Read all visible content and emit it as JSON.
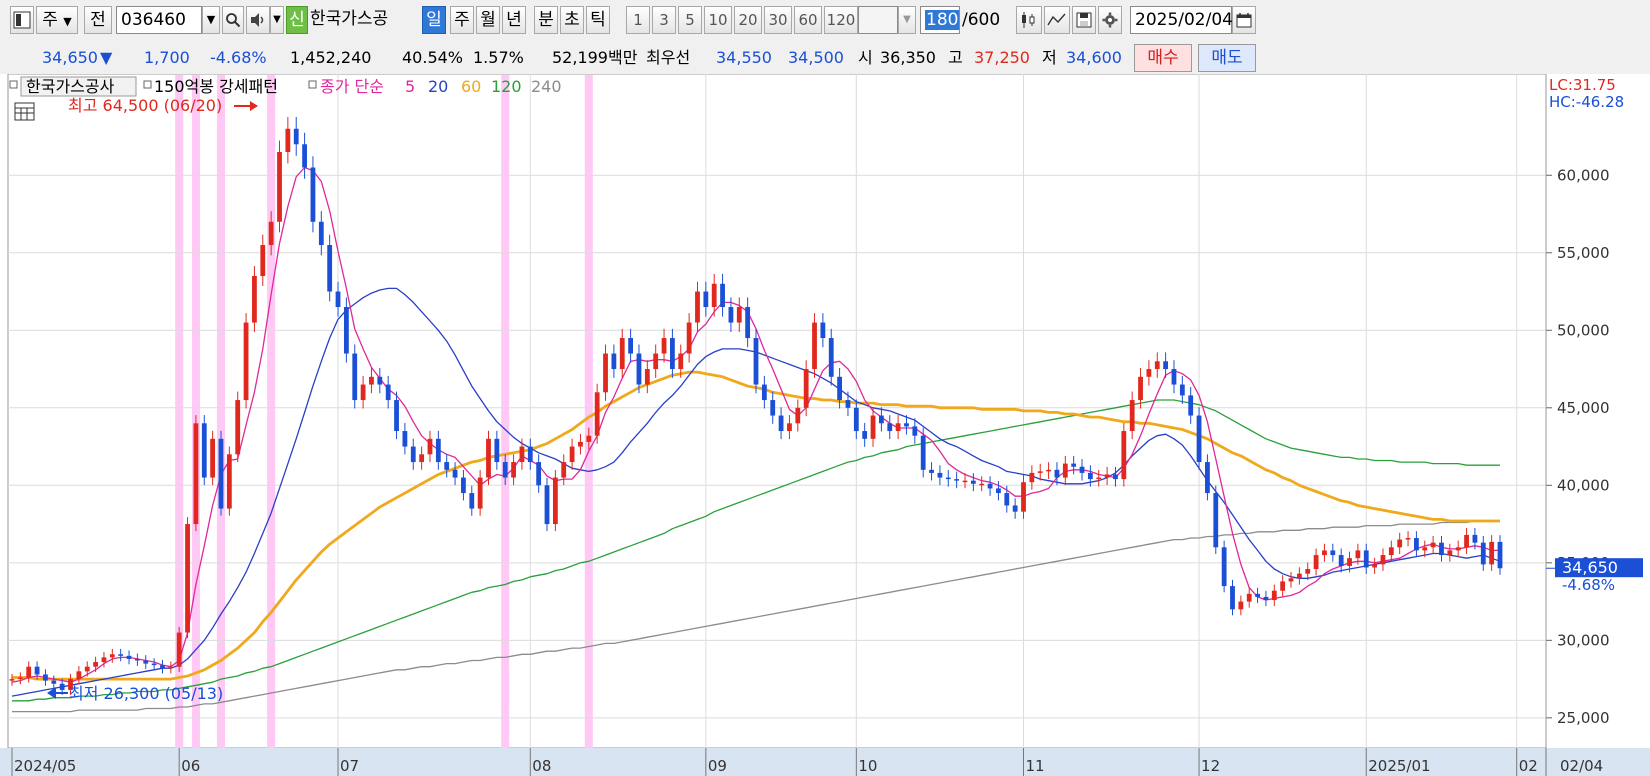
{
  "toolbar": {
    "type_label": "주",
    "prev_label": "전",
    "code": "036460",
    "new_badge": "신",
    "stock_name": "한국가스공",
    "periods": [
      "일",
      "주",
      "월",
      "년",
      "분",
      "초",
      "틱"
    ],
    "active_period": "일",
    "interval_numbers": [
      "1",
      "3",
      "5",
      "10",
      "20",
      "30",
      "60",
      "120"
    ],
    "count_value": "180",
    "count_max": "/600",
    "date": "2025/02/04"
  },
  "quote": {
    "price": "34,650",
    "direction": "▼",
    "change": "1,700",
    "change_pct": "-4.68%",
    "volume": "1,452,240",
    "ratio1": "40.54%",
    "ratio2": "1.57%",
    "amount": "52,199백만",
    "best_label": "최우선",
    "best_ask": "34,550",
    "best_bid": "34,500",
    "open_label": "시",
    "open": "36,350",
    "high_label": "고",
    "high": "37,250",
    "low_label": "저",
    "low": "34,600",
    "buy_label": "매수",
    "sell_label": "매도"
  },
  "colors": {
    "up": "#e0281e",
    "down": "#1a4fd6",
    "ma5": "#e0289a",
    "ma20": "#2a3fc8",
    "ma60": "#f0a81c",
    "ma120": "#2aa03a",
    "ma240": "#8c8c8c",
    "pattern": "#ffc8f5"
  },
  "chart_data": {
    "type": "candlestick",
    "legend_name": "한국가스공사",
    "pattern_label": "150억봉 강세패턴",
    "ma_label": "종가 단순",
    "ma_periods": [
      "5",
      "20",
      "60",
      "120",
      "240"
    ],
    "corner_labels": [
      "LC:31.75",
      "HC:-46.28"
    ],
    "price_tag": "34,650",
    "pct_tag": "-4.68%",
    "high_annotation": "최고 64,500 (06/20)",
    "low_annotation": "최저 26,300 (05/13)",
    "y_ticks": [
      "60,000",
      "55,000",
      "50,000",
      "45,000",
      "40,000",
      "35,000",
      "30,000",
      "25,000"
    ],
    "ylim": [
      23700,
      65500
    ],
    "x_labels": [
      "2024/05",
      "06",
      "07",
      "08",
      "09",
      "10",
      "11",
      "12",
      "2025/01",
      "02"
    ],
    "last_date": "02/04",
    "dates": [
      "2024-05-02",
      "2024-05-03",
      "2024-05-07",
      "2024-05-08",
      "2024-05-09",
      "2024-05-10",
      "2024-05-13",
      "2024-05-14",
      "2024-05-16",
      "2024-05-17",
      "2024-05-20",
      "2024-05-21",
      "2024-05-22",
      "2024-05-23",
      "2024-05-24",
      "2024-05-27",
      "2024-05-28",
      "2024-05-29",
      "2024-05-30",
      "2024-05-31",
      "2024-06-03",
      "2024-06-04",
      "2024-06-05",
      "2024-06-07",
      "2024-06-10",
      "2024-06-11",
      "2024-06-12",
      "2024-06-13",
      "2024-06-14",
      "2024-06-17",
      "2024-06-18",
      "2024-06-19",
      "2024-06-20",
      "2024-06-21",
      "2024-06-24",
      "2024-06-25",
      "2024-06-26",
      "2024-06-27",
      "2024-06-28",
      "2024-07-01",
      "2024-07-02",
      "2024-07-03",
      "2024-07-04",
      "2024-07-05",
      "2024-07-08",
      "2024-07-09",
      "2024-07-10",
      "2024-07-11",
      "2024-07-12",
      "2024-07-15",
      "2024-07-16",
      "2024-07-17",
      "2024-07-18",
      "2024-07-19",
      "2024-07-22",
      "2024-07-23",
      "2024-07-24",
      "2024-07-25",
      "2024-07-26",
      "2024-07-29",
      "2024-07-30",
      "2024-07-31",
      "2024-08-01",
      "2024-08-02",
      "2024-08-05",
      "2024-08-06",
      "2024-08-07",
      "2024-08-08",
      "2024-08-09",
      "2024-08-12",
      "2024-08-13",
      "2024-08-14",
      "2024-08-16",
      "2024-08-19",
      "2024-08-20",
      "2024-08-21",
      "2024-08-22",
      "2024-08-23",
      "2024-08-26",
      "2024-08-27",
      "2024-08-28",
      "2024-08-29",
      "2024-08-30",
      "2024-09-02",
      "2024-09-03",
      "2024-09-04",
      "2024-09-05",
      "2024-09-06",
      "2024-09-09",
      "2024-09-10",
      "2024-09-11",
      "2024-09-12",
      "2024-09-13",
      "2024-09-19",
      "2024-09-20",
      "2024-09-23",
      "2024-09-24",
      "2024-09-25",
      "2024-09-26",
      "2024-09-27",
      "2024-09-30",
      "2024-10-02",
      "2024-10-04",
      "2024-10-07",
      "2024-10-08",
      "2024-10-10",
      "2024-10-11",
      "2024-10-14",
      "2024-10-15",
      "2024-10-16",
      "2024-10-17",
      "2024-10-18",
      "2024-10-21",
      "2024-10-22",
      "2024-10-23",
      "2024-10-24",
      "2024-10-25",
      "2024-10-28",
      "2024-10-29",
      "2024-10-30",
      "2024-10-31",
      "2024-11-01",
      "2024-11-04",
      "2024-11-05",
      "2024-11-06",
      "2024-11-07",
      "2024-11-08",
      "2024-11-11",
      "2024-11-12",
      "2024-11-13",
      "2024-11-14",
      "2024-11-15",
      "2024-11-18",
      "2024-11-19",
      "2024-11-20",
      "2024-11-21",
      "2024-11-22",
      "2024-11-25",
      "2024-11-26",
      "2024-11-27",
      "2024-11-28",
      "2024-11-29",
      "2024-12-02",
      "2024-12-03",
      "2024-12-04",
      "2024-12-05",
      "2024-12-06",
      "2024-12-09",
      "2024-12-10",
      "2024-12-11",
      "2024-12-12",
      "2024-12-13",
      "2024-12-16",
      "2024-12-17",
      "2024-12-18",
      "2024-12-19",
      "2024-12-20",
      "2024-12-23",
      "2024-12-24",
      "2024-12-26",
      "2024-12-27",
      "2024-12-30",
      "2025-01-02",
      "2025-01-03",
      "2025-01-06",
      "2025-01-07",
      "2025-01-08",
      "2025-01-09",
      "2025-01-10",
      "2025-01-13",
      "2025-01-14",
      "2025-01-15",
      "2025-01-16",
      "2025-01-17",
      "2025-01-20",
      "2025-01-21",
      "2025-01-22",
      "2025-01-23",
      "2025-01-24",
      "2025-01-31",
      "2025-02-03",
      "2025-02-04"
    ],
    "close": [
      27500,
      27600,
      28300,
      27800,
      27400,
      27200,
      26800,
      27500,
      28000,
      28300,
      28600,
      28900,
      29100,
      29000,
      28800,
      28700,
      28500,
      28400,
      28200,
      28300,
      30500,
      37500,
      44000,
      40500,
      43000,
      38500,
      42000,
      45500,
      50500,
      53500,
      55500,
      57000,
      61500,
      63000,
      62000,
      60500,
      57000,
      55500,
      52500,
      51500,
      48500,
      45500,
      46500,
      47000,
      46500,
      45500,
      43500,
      42500,
      41500,
      42000,
      43000,
      41500,
      41000,
      40500,
      39500,
      38500,
      40500,
      43000,
      41500,
      40500,
      41500,
      42500,
      41500,
      40000,
      37500,
      40500,
      41500,
      42500,
      42800,
      43200,
      46000,
      48500,
      47500,
      49500,
      48500,
      46500,
      47500,
      48500,
      49500,
      47500,
      48500,
      50500,
      52500,
      51500,
      53000,
      51500,
      50500,
      51500,
      49500,
      46500,
      45500,
      44500,
      43500,
      44000,
      45000,
      47500,
      50500,
      49500,
      47000,
      45500,
      45000,
      43500,
      43000,
      44500,
      44000,
      43500,
      44000,
      43800,
      43200,
      41000,
      40800,
      40500,
      40400,
      40300,
      40300,
      40100,
      40100,
      39800,
      39500,
      38700,
      38300,
      40200,
      40800,
      40900,
      41000,
      40500,
      41400,
      41200,
      40800,
      40400,
      40500,
      40700,
      40400,
      43500,
      45500,
      47000,
      47500,
      48000,
      47500,
      46500,
      45800,
      44500,
      41500,
      39500,
      36000,
      33500,
      32000,
      32500,
      33000,
      32800,
      32600,
      33200,
      33800,
      34000,
      34300,
      34600,
      35500,
      35800,
      35500,
      34800,
      35300,
      35800,
      34700,
      34900,
      35500,
      36000,
      36500,
      36600,
      35800,
      36000,
      36300,
      35500,
      35800,
      36000,
      36800,
      36300,
      34900,
      36350,
      34650
    ],
    "ma5": [
      27300,
      27400,
      27600,
      27700,
      27600,
      27500,
      27400,
      27300,
      27500,
      27800,
      28100,
      28500,
      28800,
      28900,
      28900,
      28800,
      28700,
      28600,
      28400,
      28300,
      28700,
      30500,
      33600,
      36100,
      38700,
      40700,
      41600,
      41700,
      43900,
      46000,
      48800,
      52300,
      55600,
      58000,
      59900,
      60500,
      60300,
      59600,
      57700,
      55100,
      52700,
      50100,
      48800,
      47600,
      46900,
      46200,
      45800,
      45100,
      44100,
      43200,
      42700,
      42300,
      42000,
      41800,
      41200,
      40600,
      40000,
      40400,
      40700,
      40600,
      41100,
      41900,
      41600,
      41300,
      40600,
      40300,
      40400,
      40400,
      41000,
      42200,
      43200,
      44700,
      45700,
      46900,
      48000,
      48100,
      48000,
      48100,
      48100,
      48000,
      48300,
      48800,
      49900,
      50400,
      51200,
      51800,
      51800,
      51600,
      51200,
      50100,
      48700,
      47500,
      46200,
      44900,
      44500,
      45000,
      46200,
      47400,
      47900,
      48000,
      47500,
      46700,
      45500,
      44800,
      44400,
      44000,
      43700,
      43700,
      43700,
      43300,
      42900,
      42200,
      41400,
      41000,
      40700,
      40500,
      40300,
      40200,
      40000,
      39700,
      39300,
      39300,
      39500,
      39600,
      39800,
      40500,
      40900,
      41000,
      41000,
      40900,
      40700,
      40600,
      40500,
      41100,
      42000,
      43200,
      44600,
      45900,
      47100,
      47400,
      47200,
      46800,
      45800,
      44100,
      41700,
      39300,
      36900,
      34900,
      33400,
      32800,
      32600,
      32700,
      32800,
      32900,
      33100,
      33500,
      33800,
      34300,
      34600,
      34800,
      35000,
      35100,
      35100,
      35000,
      35100,
      35200,
      35300,
      35600,
      35900,
      36100,
      36200,
      36000,
      35900,
      35900,
      36000,
      36100,
      36000,
      35800,
      35800
    ],
    "ma20": [
      26400,
      26500,
      26600,
      26700,
      26800,
      26900,
      27000,
      27100,
      27200,
      27300,
      27400,
      27500,
      27600,
      27700,
      27800,
      27900,
      28000,
      28100,
      28200,
      28200,
      28400,
      28800,
      29400,
      30000,
      30800,
      31700,
      32500,
      33400,
      34400,
      35600,
      36900,
      38200,
      39800,
      41400,
      43000,
      44700,
      46400,
      48000,
      49500,
      50700,
      51300,
      51700,
      52100,
      52400,
      52600,
      52700,
      52700,
      52300,
      51800,
      51200,
      50600,
      50000,
      49300,
      48400,
      47400,
      46400,
      45600,
      44800,
      44100,
      43600,
      43100,
      42700,
      42400,
      42100,
      41900,
      41700,
      41400,
      41100,
      41000,
      40900,
      41000,
      41200,
      41500,
      42100,
      42800,
      43400,
      44000,
      44700,
      45300,
      45800,
      46400,
      47100,
      47800,
      48300,
      48600,
      48800,
      48800,
      48800,
      48700,
      48600,
      48400,
      48200,
      48000,
      47800,
      47600,
      47400,
      47200,
      46900,
      46600,
      46200,
      45800,
      45400,
      45200,
      45000,
      44900,
      44800,
      44600,
      44400,
      44200,
      43800,
      43400,
      43000,
      42700,
      42500,
      42200,
      41900,
      41600,
      41400,
      41200,
      40900,
      40800,
      40700,
      40600,
      40400,
      40300,
      40200,
      40100,
      40100,
      40100,
      40200,
      40300,
      40500,
      40800,
      41300,
      41900,
      42400,
      42900,
      43200,
      43300,
      43000,
      42600,
      41900,
      41100,
      40300,
      39600,
      38900,
      38100,
      37300,
      36500,
      35800,
      35100,
      34600,
      34300,
      34100,
      34000,
      34000,
      34100,
      34200,
      34400,
      34500,
      34600,
      34700,
      34800,
      34900,
      35000,
      35100,
      35200,
      35300,
      35400,
      35500,
      35600,
      35600,
      35500,
      35400,
      35300,
      35400,
      35500,
      35300,
      35100
    ],
    "ma60": [
      27600,
      27600,
      27600,
      27500,
      27500,
      27500,
      27500,
      27500,
      27500,
      27500,
      27500,
      27500,
      27500,
      27500,
      27500,
      27500,
      27500,
      27500,
      27500,
      27500,
      27600,
      27700,
      27900,
      28100,
      28400,
      28700,
      29100,
      29500,
      30000,
      30500,
      31200,
      31800,
      32500,
      33200,
      33900,
      34500,
      35100,
      35700,
      36200,
      36600,
      37000,
      37400,
      37800,
      38200,
      38600,
      38900,
      39200,
      39500,
      39800,
      40100,
      40400,
      40700,
      40900,
      41100,
      41300,
      41500,
      41600,
      41800,
      41900,
      42000,
      42100,
      42200,
      42300,
      42500,
      42700,
      43000,
      43300,
      43600,
      44000,
      44400,
      44700,
      45100,
      45400,
      45700,
      46000,
      46300,
      46500,
      46700,
      46900,
      47100,
      47200,
      47300,
      47300,
      47200,
      47100,
      47000,
      46800,
      46600,
      46400,
      46300,
      46200,
      46000,
      45900,
      45800,
      45700,
      45600,
      45600,
      45500,
      45500,
      45400,
      45400,
      45300,
      45300,
      45300,
      45200,
      45200,
      45200,
      45100,
      45100,
      45100,
      45100,
      45000,
      45000,
      45000,
      45000,
      45000,
      44900,
      44900,
      44900,
      44900,
      44900,
      44800,
      44800,
      44800,
      44700,
      44700,
      44600,
      44600,
      44500,
      44400,
      44400,
      44300,
      44200,
      44100,
      44100,
      44000,
      44000,
      43900,
      43800,
      43700,
      43600,
      43400,
      43200,
      43000,
      42700,
      42400,
      42100,
      41900,
      41600,
      41300,
      41000,
      40800,
      40500,
      40300,
      40000,
      39800,
      39600,
      39400,
      39200,
      39000,
      38900,
      38700,
      38600,
      38500,
      38400,
      38300,
      38200,
      38100,
      38000,
      37900,
      37800,
      37800,
      37700,
      37700,
      37700,
      37700,
      37700,
      37700,
      37700
    ],
    "ma120": [
      26100,
      26100,
      26100,
      26200,
      26200,
      26300,
      26300,
      26300,
      26400,
      26400,
      26400,
      26500,
      26500,
      26600,
      26600,
      26700,
      26700,
      26700,
      26800,
      26800,
      26900,
      27000,
      27100,
      27200,
      27300,
      27500,
      27600,
      27700,
      27900,
      28000,
      28200,
      28300,
      28500,
      28700,
      28900,
      29100,
      29300,
      29500,
      29700,
      29900,
      30100,
      30300,
      30500,
      30700,
      30900,
      31100,
      31300,
      31500,
      31700,
      31900,
      32100,
      32300,
      32500,
      32700,
      32900,
      33100,
      33200,
      33400,
      33500,
      33600,
      33800,
      33900,
      34100,
      34200,
      34300,
      34500,
      34600,
      34800,
      35000,
      35100,
      35300,
      35500,
      35700,
      35900,
      36100,
      36300,
      36500,
      36700,
      36900,
      37200,
      37400,
      37600,
      37800,
      38000,
      38300,
      38500,
      38700,
      38900,
      39100,
      39300,
      39500,
      39700,
      39900,
      40100,
      40300,
      40500,
      40700,
      40900,
      41100,
      41300,
      41500,
      41600,
      41800,
      41900,
      42100,
      42200,
      42300,
      42500,
      42600,
      42700,
      42800,
      42900,
      43000,
      43100,
      43200,
      43300,
      43400,
      43500,
      43600,
      43700,
      43800,
      43900,
      44000,
      44100,
      44200,
      44300,
      44400,
      44500,
      44600,
      44700,
      44800,
      44900,
      45000,
      45100,
      45200,
      45300,
      45400,
      45500,
      45500,
      45500,
      45400,
      45300,
      45200,
      45000,
      44800,
      44500,
      44200,
      43900,
      43600,
      43300,
      43000,
      42800,
      42600,
      42400,
      42300,
      42200,
      42100,
      42000,
      41900,
      41800,
      41800,
      41700,
      41700,
      41600,
      41600,
      41600,
      41500,
      41500,
      41500,
      41500,
      41400,
      41400,
      41400,
      41400,
      41300,
      41300,
      41300,
      41300,
      41300
    ],
    "ma240": [
      25400,
      25400,
      25400,
      25400,
      25400,
      25400,
      25400,
      25400,
      25500,
      25500,
      25500,
      25500,
      25500,
      25500,
      25500,
      25500,
      25600,
      25600,
      25600,
      25600,
      25700,
      25700,
      25800,
      25900,
      25900,
      26000,
      26100,
      26200,
      26300,
      26400,
      26500,
      26600,
      26700,
      26800,
      26900,
      27000,
      27100,
      27200,
      27300,
      27400,
      27500,
      27600,
      27700,
      27800,
      27900,
      28000,
      28100,
      28100,
      28200,
      28300,
      28300,
      28400,
      28500,
      28500,
      28600,
      28700,
      28700,
      28800,
      28900,
      28900,
      29000,
      29100,
      29100,
      29200,
      29300,
      29300,
      29400,
      29500,
      29500,
      29600,
      29700,
      29800,
      29800,
      29900,
      30000,
      30100,
      30200,
      30300,
      30400,
      30500,
      30600,
      30700,
      30800,
      30900,
      31000,
      31100,
      31200,
      31300,
      31400,
      31500,
      31600,
      31700,
      31800,
      31900,
      32000,
      32100,
      32200,
      32300,
      32400,
      32500,
      32600,
      32700,
      32800,
      32900,
      33000,
      33100,
      33200,
      33300,
      33400,
      33500,
      33600,
      33700,
      33800,
      33900,
      34000,
      34100,
      34200,
      34300,
      34400,
      34500,
      34600,
      34700,
      34800,
      34900,
      35000,
      35100,
      35200,
      35300,
      35400,
      35500,
      35600,
      35700,
      35800,
      35900,
      36000,
      36100,
      36200,
      36300,
      36400,
      36500,
      36500,
      36600,
      36600,
      36700,
      36700,
      36800,
      36800,
      36900,
      36900,
      37000,
      37000,
      37000,
      37100,
      37100,
      37100,
      37200,
      37200,
      37200,
      37300,
      37300,
      37300,
      37300,
      37400,
      37400,
      37400,
      37400,
      37500,
      37500,
      37500,
      37500,
      37500,
      37600,
      37600,
      37600,
      37600,
      37700,
      37700,
      37700,
      37700
    ],
    "pattern_dates": [
      "2024-06-03",
      "2024-06-05",
      "2024-06-11",
      "2024-06-19",
      "2024-07-29",
      "2024-08-12"
    ]
  }
}
